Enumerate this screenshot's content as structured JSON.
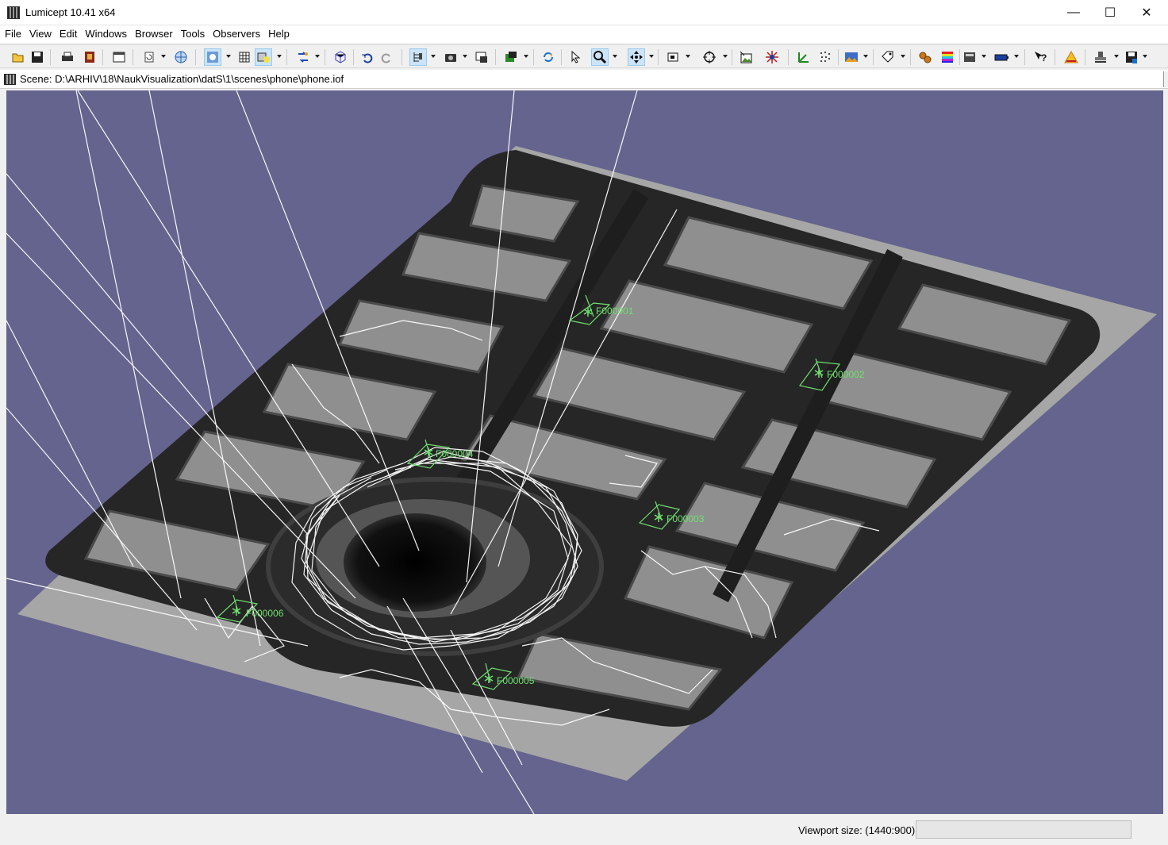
{
  "window": {
    "title": "Lumicept 10.41 x64",
    "minimize_glyph": "—",
    "maximize_glyph": "☐",
    "close_glyph": "✕"
  },
  "menu": [
    "File",
    "View",
    "Edit",
    "Windows",
    "Browser",
    "Tools",
    "Observers",
    "Help"
  ],
  "scene": {
    "title": "Scene: D:\\ARHIV\\18\\NaukVisualization\\datS\\1\\scenes\\phone\\phone.iof"
  },
  "viewport": {
    "background_color": "#65648e",
    "observers": [
      "F000001",
      "F000002",
      "F000003",
      "F000004",
      "F000005",
      "F000006"
    ]
  },
  "toolbar": {
    "icons": [
      "open-icon",
      "save-icon",
      "print-icon",
      "book-icon",
      "window-icon",
      "rotate-icon",
      "globe-icon",
      "light-icon",
      "grid-icon",
      "scene-color-icon",
      "transform-icon",
      "cube-icon",
      "undo-icon",
      "redo-icon",
      "tree-icon",
      "camera-icon",
      "screenshot-icon",
      "object-icon",
      "refresh-icon",
      "pointer-icon",
      "zoom-icon",
      "pan-icon",
      "frame-icon",
      "target-icon",
      "snapshot-icon",
      "rays-icon",
      "axes-icon",
      "points-icon",
      "landscape-icon",
      "tag-icon",
      "gears-icon",
      "palette-icon",
      "calculator-icon",
      "battery-icon",
      "help-icon",
      "warning-icon",
      "stamp-icon",
      "save-as-icon"
    ]
  },
  "status": {
    "viewport_size": "Viewport size: (1440:900)"
  }
}
